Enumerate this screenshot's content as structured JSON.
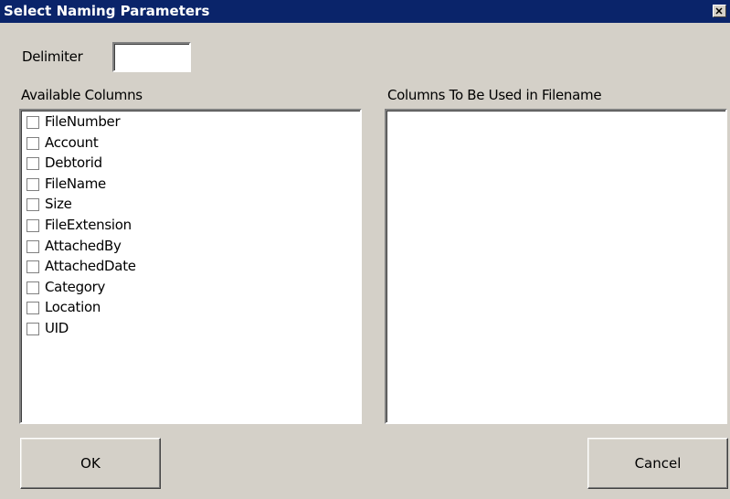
{
  "window": {
    "title": "Select Naming Parameters",
    "close_icon": "close-icon"
  },
  "delimiter": {
    "label": "Delimiter",
    "value": ""
  },
  "available": {
    "label": "Available Columns",
    "items": [
      {
        "label": "FileNumber",
        "checked": false
      },
      {
        "label": "Account",
        "checked": false
      },
      {
        "label": "Debtorid",
        "checked": false
      },
      {
        "label": "FileName",
        "checked": false
      },
      {
        "label": "Size",
        "checked": false
      },
      {
        "label": "FileExtension",
        "checked": false
      },
      {
        "label": "AttachedBy",
        "checked": false
      },
      {
        "label": "AttachedDate",
        "checked": false
      },
      {
        "label": "Category",
        "checked": false
      },
      {
        "label": "Location",
        "checked": false
      },
      {
        "label": "UID",
        "checked": false
      }
    ]
  },
  "selected": {
    "label": "Columns To Be Used in Filename",
    "items": []
  },
  "buttons": {
    "ok": "OK",
    "cancel": "Cancel"
  },
  "colors": {
    "titlebar": "#0a246a",
    "face": "#d4d0c8"
  }
}
